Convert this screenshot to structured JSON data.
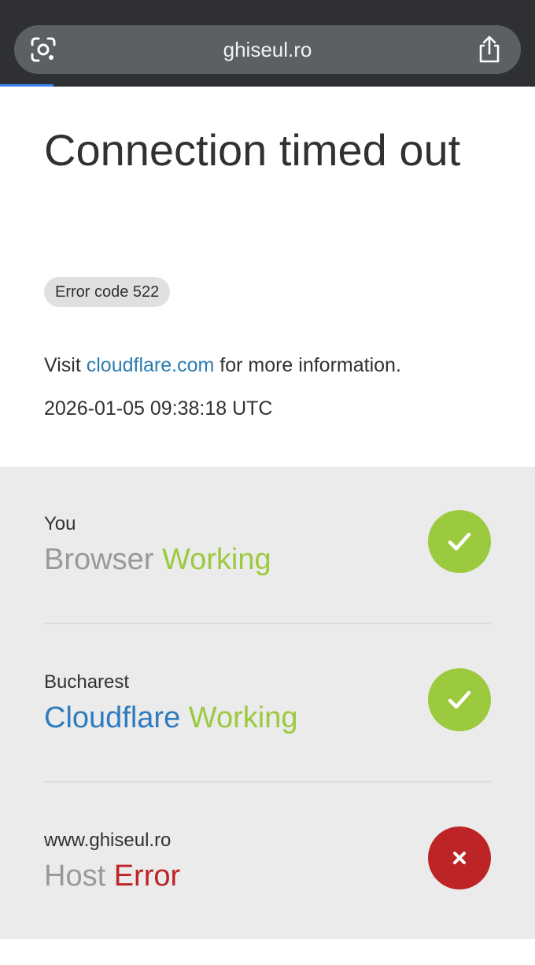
{
  "browser": {
    "url": "ghiseul.ro",
    "icons": [
      "google-lens-icon",
      "share-icon"
    ]
  },
  "error": {
    "title": "Connection timed out",
    "code": "Error code 522",
    "visit_prefix": "Visit ",
    "visit_link": "cloudflare.com",
    "visit_suffix": " for more information.",
    "timestamp": "2026-01-05 09:38:18 UTC"
  },
  "status": {
    "rows": [
      {
        "location": "You",
        "name": "Browser",
        "state": "Working",
        "result": "ok",
        "name_color": "#999999",
        "state_color": "#9bca3e",
        "icon": "check-icon"
      },
      {
        "location": "Bucharest",
        "name": "Cloudflare",
        "state": "Working",
        "result": "ok",
        "name_color": "#2f7bbf",
        "state_color": "#9bca3e",
        "icon": "check-icon"
      },
      {
        "location": "www.ghiseul.ro",
        "name": "Host",
        "state": "Error",
        "result": "error",
        "name_color": "#999999",
        "state_color": "#bd2426",
        "icon": "close-icon"
      }
    ]
  },
  "colors": {
    "success": "#9bca3e",
    "error": "#bd2426",
    "link": "#2c7cb0",
    "browser_chrome": "#2e3033"
  }
}
